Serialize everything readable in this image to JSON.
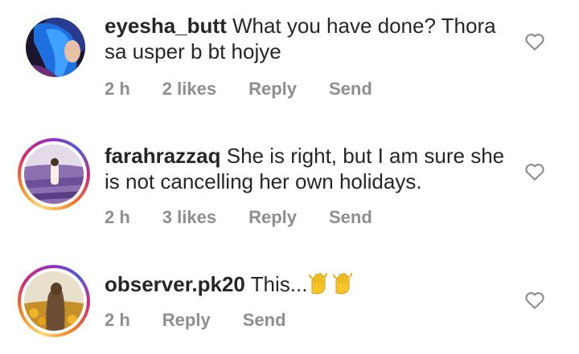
{
  "comments": [
    {
      "username": "eyesha_butt",
      "text": "What you have done? Thora sa usper b bt hojye",
      "time": "2 h",
      "likes": "2 likes",
      "reply": "Reply",
      "send": "Send"
    },
    {
      "username": "farahrazzaq",
      "text": "She is right, but I am sure she is not cancelling her own holidays.",
      "time": "2 h",
      "likes": "3 likes",
      "reply": "Reply",
      "send": "Send"
    },
    {
      "username": "observer.pk20",
      "text": "This...",
      "time": "2 h",
      "reply": "Reply",
      "send": "Send"
    }
  ],
  "icons": {
    "like": "heart-outline-icon",
    "emoji": "raising-hands-emoji"
  },
  "colors": {
    "text": "#262626",
    "meta": "#8e8e8e",
    "heart": "#8e8e8e"
  }
}
